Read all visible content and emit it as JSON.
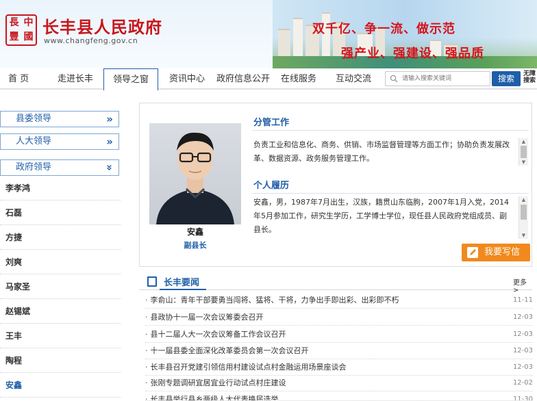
{
  "header": {
    "seal_chars": [
      "長",
      "中",
      "豐",
      "國"
    ],
    "site_title": "长丰县人民政府",
    "site_url": "www.changfeng.gov.cn",
    "slogan_line1": "双千亿、争一流、做示范",
    "slogan_line2": "强产业、强建设、强品质"
  },
  "nav": {
    "items": [
      "首 页",
      "走进长丰",
      "领导之窗",
      "资讯中心",
      "政府信息公开",
      "在线服务",
      "互动交流"
    ],
    "active_index": 2,
    "search_placeholder": "请输入搜索关键词",
    "search_button": "搜索",
    "edge_text": "无障 搜索"
  },
  "sidebar": {
    "groups": [
      "县委领导",
      "人大领导",
      "政府领导"
    ],
    "leaders": [
      "李孝鸿",
      "石磊",
      "方捷",
      "刘爽",
      "马家圣",
      "赵锡斌",
      "王丰",
      "陶程",
      "安鑫"
    ],
    "active_leader": "安鑫"
  },
  "profile": {
    "name": "安鑫",
    "title": "副县长",
    "duty_heading": "分管工作",
    "duty_text": "负责工业和信息化、商务、供销、市场监督管理等方面工作；协助负责发展改革、数据资源、政务服务管理工作。",
    "resume_heading": "个人履历",
    "resume_text": "安鑫，男，1987年7月出生，汉族，籍贯山东临朐，2007年1月入党，2014年5月参加工作，研究生学历，工学博士学位，现任县人民政府党组成员、副县长。",
    "write_button": "我要写信"
  },
  "news": {
    "heading": "长丰要闻",
    "more": "更多>",
    "items": [
      {
        "title": "李俞山：青年干部要勇当闯将、猛将、干将，力争出手即出彩、出彩即不朽",
        "date": "11-11"
      },
      {
        "title": "县政协十一届一次会议筹委会召开",
        "date": "12-03"
      },
      {
        "title": "县十二届人大一次会议筹备工作会议召开",
        "date": "12-03"
      },
      {
        "title": "十一届县委全面深化改革委员会第一次会议召开",
        "date": "12-03"
      },
      {
        "title": "长丰县召开党建引领信用村建设试点村金融运用场景座谈会",
        "date": "12-03"
      },
      {
        "title": "张刚专题调研宜居宜业行动试点村庄建设",
        "date": "12-02"
      },
      {
        "title": "长丰县举行县乡两级人大代表换届选举",
        "date": "11-30"
      }
    ]
  },
  "colors": {
    "brand_red": "#c8161d",
    "link_blue": "#1f5fa8",
    "write_orange": "#f08a1e"
  }
}
